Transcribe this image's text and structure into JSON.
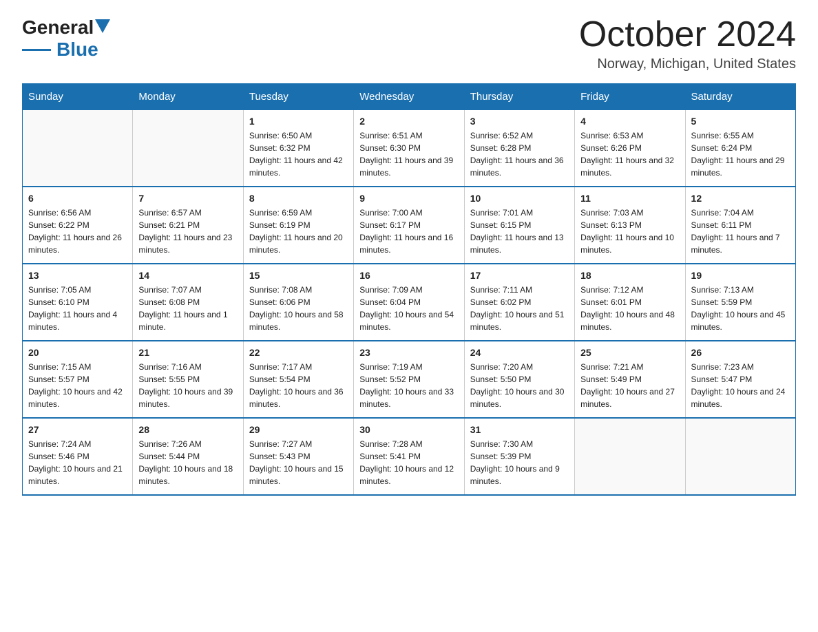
{
  "header": {
    "logo_general": "General",
    "logo_blue": "Blue",
    "month_title": "October 2024",
    "location": "Norway, Michigan, United States"
  },
  "days_of_week": [
    "Sunday",
    "Monday",
    "Tuesday",
    "Wednesday",
    "Thursday",
    "Friday",
    "Saturday"
  ],
  "weeks": [
    [
      {
        "day": "",
        "sunrise": "",
        "sunset": "",
        "daylight": ""
      },
      {
        "day": "",
        "sunrise": "",
        "sunset": "",
        "daylight": ""
      },
      {
        "day": "1",
        "sunrise": "Sunrise: 6:50 AM",
        "sunset": "Sunset: 6:32 PM",
        "daylight": "Daylight: 11 hours and 42 minutes."
      },
      {
        "day": "2",
        "sunrise": "Sunrise: 6:51 AM",
        "sunset": "Sunset: 6:30 PM",
        "daylight": "Daylight: 11 hours and 39 minutes."
      },
      {
        "day": "3",
        "sunrise": "Sunrise: 6:52 AM",
        "sunset": "Sunset: 6:28 PM",
        "daylight": "Daylight: 11 hours and 36 minutes."
      },
      {
        "day": "4",
        "sunrise": "Sunrise: 6:53 AM",
        "sunset": "Sunset: 6:26 PM",
        "daylight": "Daylight: 11 hours and 32 minutes."
      },
      {
        "day": "5",
        "sunrise": "Sunrise: 6:55 AM",
        "sunset": "Sunset: 6:24 PM",
        "daylight": "Daylight: 11 hours and 29 minutes."
      }
    ],
    [
      {
        "day": "6",
        "sunrise": "Sunrise: 6:56 AM",
        "sunset": "Sunset: 6:22 PM",
        "daylight": "Daylight: 11 hours and 26 minutes."
      },
      {
        "day": "7",
        "sunrise": "Sunrise: 6:57 AM",
        "sunset": "Sunset: 6:21 PM",
        "daylight": "Daylight: 11 hours and 23 minutes."
      },
      {
        "day": "8",
        "sunrise": "Sunrise: 6:59 AM",
        "sunset": "Sunset: 6:19 PM",
        "daylight": "Daylight: 11 hours and 20 minutes."
      },
      {
        "day": "9",
        "sunrise": "Sunrise: 7:00 AM",
        "sunset": "Sunset: 6:17 PM",
        "daylight": "Daylight: 11 hours and 16 minutes."
      },
      {
        "day": "10",
        "sunrise": "Sunrise: 7:01 AM",
        "sunset": "Sunset: 6:15 PM",
        "daylight": "Daylight: 11 hours and 13 minutes."
      },
      {
        "day": "11",
        "sunrise": "Sunrise: 7:03 AM",
        "sunset": "Sunset: 6:13 PM",
        "daylight": "Daylight: 11 hours and 10 minutes."
      },
      {
        "day": "12",
        "sunrise": "Sunrise: 7:04 AM",
        "sunset": "Sunset: 6:11 PM",
        "daylight": "Daylight: 11 hours and 7 minutes."
      }
    ],
    [
      {
        "day": "13",
        "sunrise": "Sunrise: 7:05 AM",
        "sunset": "Sunset: 6:10 PM",
        "daylight": "Daylight: 11 hours and 4 minutes."
      },
      {
        "day": "14",
        "sunrise": "Sunrise: 7:07 AM",
        "sunset": "Sunset: 6:08 PM",
        "daylight": "Daylight: 11 hours and 1 minute."
      },
      {
        "day": "15",
        "sunrise": "Sunrise: 7:08 AM",
        "sunset": "Sunset: 6:06 PM",
        "daylight": "Daylight: 10 hours and 58 minutes."
      },
      {
        "day": "16",
        "sunrise": "Sunrise: 7:09 AM",
        "sunset": "Sunset: 6:04 PM",
        "daylight": "Daylight: 10 hours and 54 minutes."
      },
      {
        "day": "17",
        "sunrise": "Sunrise: 7:11 AM",
        "sunset": "Sunset: 6:02 PM",
        "daylight": "Daylight: 10 hours and 51 minutes."
      },
      {
        "day": "18",
        "sunrise": "Sunrise: 7:12 AM",
        "sunset": "Sunset: 6:01 PM",
        "daylight": "Daylight: 10 hours and 48 minutes."
      },
      {
        "day": "19",
        "sunrise": "Sunrise: 7:13 AM",
        "sunset": "Sunset: 5:59 PM",
        "daylight": "Daylight: 10 hours and 45 minutes."
      }
    ],
    [
      {
        "day": "20",
        "sunrise": "Sunrise: 7:15 AM",
        "sunset": "Sunset: 5:57 PM",
        "daylight": "Daylight: 10 hours and 42 minutes."
      },
      {
        "day": "21",
        "sunrise": "Sunrise: 7:16 AM",
        "sunset": "Sunset: 5:55 PM",
        "daylight": "Daylight: 10 hours and 39 minutes."
      },
      {
        "day": "22",
        "sunrise": "Sunrise: 7:17 AM",
        "sunset": "Sunset: 5:54 PM",
        "daylight": "Daylight: 10 hours and 36 minutes."
      },
      {
        "day": "23",
        "sunrise": "Sunrise: 7:19 AM",
        "sunset": "Sunset: 5:52 PM",
        "daylight": "Daylight: 10 hours and 33 minutes."
      },
      {
        "day": "24",
        "sunrise": "Sunrise: 7:20 AM",
        "sunset": "Sunset: 5:50 PM",
        "daylight": "Daylight: 10 hours and 30 minutes."
      },
      {
        "day": "25",
        "sunrise": "Sunrise: 7:21 AM",
        "sunset": "Sunset: 5:49 PM",
        "daylight": "Daylight: 10 hours and 27 minutes."
      },
      {
        "day": "26",
        "sunrise": "Sunrise: 7:23 AM",
        "sunset": "Sunset: 5:47 PM",
        "daylight": "Daylight: 10 hours and 24 minutes."
      }
    ],
    [
      {
        "day": "27",
        "sunrise": "Sunrise: 7:24 AM",
        "sunset": "Sunset: 5:46 PM",
        "daylight": "Daylight: 10 hours and 21 minutes."
      },
      {
        "day": "28",
        "sunrise": "Sunrise: 7:26 AM",
        "sunset": "Sunset: 5:44 PM",
        "daylight": "Daylight: 10 hours and 18 minutes."
      },
      {
        "day": "29",
        "sunrise": "Sunrise: 7:27 AM",
        "sunset": "Sunset: 5:43 PM",
        "daylight": "Daylight: 10 hours and 15 minutes."
      },
      {
        "day": "30",
        "sunrise": "Sunrise: 7:28 AM",
        "sunset": "Sunset: 5:41 PM",
        "daylight": "Daylight: 10 hours and 12 minutes."
      },
      {
        "day": "31",
        "sunrise": "Sunrise: 7:30 AM",
        "sunset": "Sunset: 5:39 PM",
        "daylight": "Daylight: 10 hours and 9 minutes."
      },
      {
        "day": "",
        "sunrise": "",
        "sunset": "",
        "daylight": ""
      },
      {
        "day": "",
        "sunrise": "",
        "sunset": "",
        "daylight": ""
      }
    ]
  ]
}
